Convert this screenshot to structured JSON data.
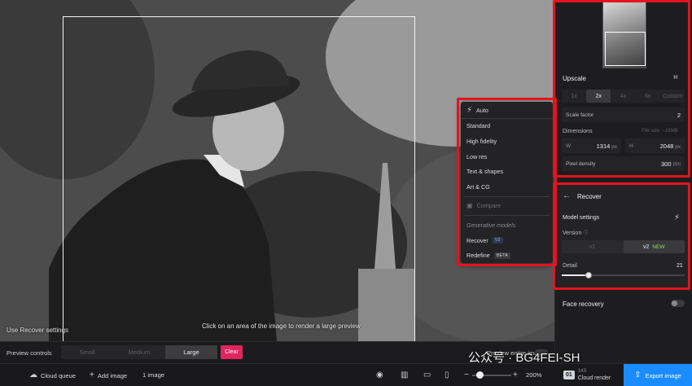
{
  "canvas": {
    "hint": "Click on an area of the image to render a large preview",
    "use_settings": "Use Recover settings"
  },
  "model_menu": {
    "auto": "Auto",
    "items": [
      "Standard",
      "High fidelity",
      "Low res",
      "Text & shapes",
      "Art & CG"
    ],
    "compare": "Compare",
    "generative_header": "Generative models",
    "recover": "Recover",
    "recover_badge": "V2",
    "redefine": "Redefine",
    "redefine_badge": "BETA"
  },
  "preview_controls": {
    "label": "Preview controls",
    "sizes": [
      "Small",
      "Medium",
      "Large"
    ],
    "selected": "Large",
    "clear": "Clear",
    "preview_entire": "Preview entire image"
  },
  "status_bar": {
    "cloud_queue": "Cloud queue",
    "add_image": "Add image",
    "image_count": "1 image",
    "zoom": "200%",
    "cloud_render_count": "01",
    "cloud_render_sub": "14S",
    "cloud_render": "Cloud render",
    "export": "Export image"
  },
  "upscale": {
    "title": "Upscale",
    "factors": [
      "1x",
      "2x",
      "4x",
      "6x",
      "Custom"
    ],
    "selected": "2x",
    "scale_factor_label": "Scale factor",
    "scale_factor_value": "2",
    "dimensions_label": "Dimensions",
    "file_size": "File size: ~15MB",
    "width_label": "W",
    "width_value": "1314",
    "height_label": "H",
    "height_value": "2048",
    "unit": "px",
    "pixel_density_label": "Pixel density",
    "pixel_density_value": "300",
    "pixel_density_unit": "PPI"
  },
  "recover": {
    "title": "Recover",
    "model_settings": "Model settings",
    "version_label": "Version",
    "versions": [
      "v1",
      "v2"
    ],
    "new_badge": "NEW",
    "detail_label": "Detail",
    "detail_value": "21",
    "detail_fraction": 0.21
  },
  "face_recovery": {
    "label": "Face recovery",
    "enabled": false
  },
  "watermark": "公众号 · BG4FEI-SH",
  "colors": {
    "accent_blue": "#1a8cff",
    "clear_pink": "#e0245e",
    "highlight_red": "#e3141f",
    "new_green": "#8be05c"
  }
}
